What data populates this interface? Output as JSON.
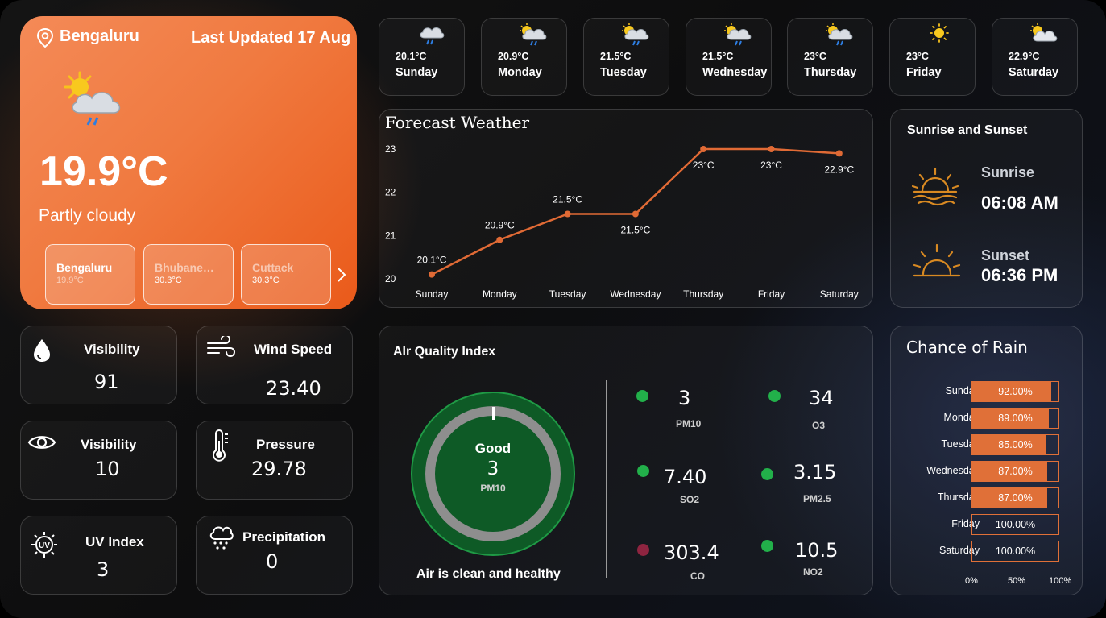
{
  "location": {
    "city": "Bengaluru",
    "last_updated": "Last Updated 17 Aug",
    "temperature": "19.9°C",
    "condition": "Partly cloudy",
    "icon": "sun-cloud-rain-icon"
  },
  "city_tiles": [
    {
      "name": "Bengaluru",
      "temp": "19.9°C"
    },
    {
      "name": "Bhubaneswar",
      "temp": "30.3°C"
    },
    {
      "name": "Cuttack",
      "temp": "30.3°C"
    }
  ],
  "days": [
    {
      "day": "Sunday",
      "temp": "20.1°C",
      "icon": "cloud-rain-icon"
    },
    {
      "day": "Monday",
      "temp": "20.9°C",
      "icon": "sun-cloud-rain-icon"
    },
    {
      "day": "Tuesday",
      "temp": "21.5°C",
      "icon": "sun-cloud-rain-icon"
    },
    {
      "day": "Wednesday",
      "temp": "21.5°C",
      "icon": "sun-cloud-rain-icon"
    },
    {
      "day": "Thursday",
      "temp": "23°C",
      "icon": "sun-cloud-rain-icon"
    },
    {
      "day": "Friday",
      "temp": "23°C",
      "icon": "sun-icon"
    },
    {
      "day": "Saturday",
      "temp": "22.9°C",
      "icon": "sun-cloud-icon"
    }
  ],
  "forecast": {
    "title": "Forecast Weather",
    "chart_data": {
      "type": "line",
      "categories": [
        "Sunday",
        "Monday",
        "Tuesday",
        "Wednesday",
        "Thursday",
        "Friday",
        "Saturday"
      ],
      "values": [
        20.1,
        20.9,
        21.5,
        21.5,
        23,
        23,
        22.9
      ],
      "labels": [
        "20.1°C",
        "20.9°C",
        "21.5°C",
        "21.5°C",
        "23°C",
        "23°C",
        "22.9°C"
      ],
      "yticks": [
        "20",
        "21",
        "22",
        "23"
      ],
      "ylim": [
        20,
        23
      ],
      "color": "#e06a35",
      "grid": false
    }
  },
  "sun": {
    "title": "Sunrise and Sunset",
    "sunrise_label": "Sunrise",
    "sunrise_time": "06:08 AM",
    "sunset_label": "Sunset",
    "sunset_time": "06:36 PM"
  },
  "stats": {
    "visibility1": {
      "label": "Visibility",
      "value": "91",
      "icon": "droplet-icon"
    },
    "wind": {
      "label": "Wind Speed",
      "value": "23.40",
      "icon": "wind-icon"
    },
    "visibility2": {
      "label": "Visibility",
      "value": "10",
      "icon": "eye-icon"
    },
    "pressure": {
      "label": "Pressure",
      "value": "29.78",
      "icon": "thermometer-icon"
    },
    "uv": {
      "label": "UV Index",
      "value": "3",
      "icon": "uv-sun-icon"
    },
    "precipitation": {
      "label": "Precipitation",
      "value": "0",
      "icon": "cloud-drizzle-icon"
    }
  },
  "aqi": {
    "title": "AIr Quality Index",
    "gauge_status": "Good",
    "gauge_value": "3",
    "gauge_metric": "PM10",
    "message": "Air is clean and healthy",
    "items": [
      {
        "value": "3",
        "label": "PM10",
        "color": "#22b04a"
      },
      {
        "value": "34",
        "label": "O3",
        "color": "#22b04a"
      },
      {
        "value": "7.40",
        "label": "SO2",
        "color": "#22b04a"
      },
      {
        "value": "3.15",
        "label": "PM2.5",
        "color": "#22b04a"
      },
      {
        "value": "303.4",
        "label": "CO",
        "color": "#8e2440"
      },
      {
        "value": "10.5",
        "label": "NO2",
        "color": "#22b04a"
      }
    ]
  },
  "rain": {
    "title": "Chance of Rain",
    "chart_data": {
      "type": "bar",
      "orientation": "horizontal",
      "categories": [
        "Sunday",
        "Monday",
        "Tuesday",
        "Wednesday",
        "Thursday",
        "Friday",
        "Saturday"
      ],
      "values": [
        92,
        89,
        85,
        87,
        87,
        100,
        100
      ],
      "labels": [
        "92.00%",
        "89.00%",
        "85.00%",
        "87.00%",
        "87.00%",
        "100.00%",
        "100.00%"
      ],
      "filled": [
        true,
        true,
        true,
        true,
        true,
        false,
        false
      ],
      "xticks": [
        "0%",
        "50%",
        "100%"
      ],
      "xlim": [
        0,
        100
      ],
      "color": "#e07038"
    }
  }
}
